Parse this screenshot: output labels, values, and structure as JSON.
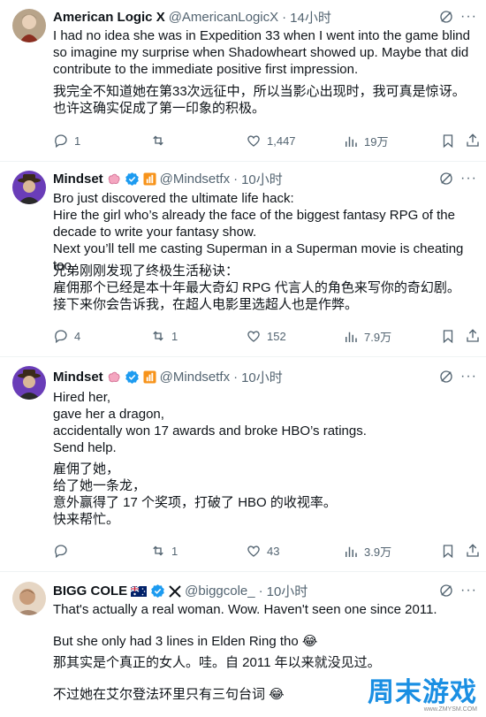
{
  "tweets": [
    {
      "name": "American Logic X",
      "handle": "@AmericanLogicX",
      "dot": "·",
      "time": "14小时",
      "text_en": "I had no idea she was in Expedition 33 when I went into the game blind so imagine my surprise when Shadowheart showed up. Maybe that did contribute to the immediate positive first impression.",
      "text_zh": "我完全不知道她在第33次远征中，所以当影心出现时，我可真是惊讶。也许这确实促成了第一印象的积极。",
      "replies": "1",
      "retweets": "",
      "likes": "1,447",
      "views": "19万"
    },
    {
      "name": "Mindset",
      "handle": "@Mindsetfx",
      "dot": "·",
      "time": "10小时",
      "text_en": "Bro just discovered the ultimate life hack:\nHire the girl who’s already the face of the biggest fantasy RPG of the decade to write your fantasy show.\nNext you’ll tell me casting Superman in a Superman movie is cheating too.",
      "text_zh": "兄弟刚刚发现了终极生活秘诀：\n雇佣那个已经是本十年最大奇幻 RPG 代言人的角色来写你的奇幻剧。\n接下来你会告诉我，在超人电影里选超人也是作弊。",
      "replies": "4",
      "retweets": "1",
      "likes": "152",
      "views": "7.9万"
    },
    {
      "name": "Mindset",
      "handle": "@Mindsetfx",
      "dot": "·",
      "time": "10小时",
      "text_en": "Hired her,\ngave her a dragon,\n accidentally won 17 awards and broke HBO’s ratings.\nSend help.",
      "text_zh": "雇佣了她，\n给了她一条龙，\n意外赢得了 17 个奖项，打破了 HBO 的收视率。\n快来帮忙。",
      "replies": "",
      "retweets": "1",
      "likes": "43",
      "views": "3.9万"
    },
    {
      "name": "BIGG COLE",
      "handle": "@biggcole_",
      "dot": "·",
      "time": "10小时",
      "text_en": "That's actually a real woman. Wow. Haven't seen one since 2011.\n\nBut she only had 3 lines in Elden Ring tho 😂",
      "text_zh": "那其实是个真正的女人。哇。自 2011 年以来就没见过。\n\n不过她在艾尔登法环里只有三句台词 😂"
    }
  ],
  "watermark": {
    "text": "周末游戏",
    "sub": "www.ZMYSM.COM"
  },
  "colors": {
    "verified": "#1d9bf0",
    "muted": "#536471",
    "divider": "#eff3f4",
    "watermark": "#1a8fe3"
  },
  "icons": [
    "reply-icon",
    "retweet-icon",
    "like-icon",
    "views-icon",
    "bookmark-icon",
    "share-icon",
    "grok-icon",
    "more-icon",
    "verified-icon",
    "brain-emoji",
    "business-badge",
    "australia-flag-icon"
  ]
}
